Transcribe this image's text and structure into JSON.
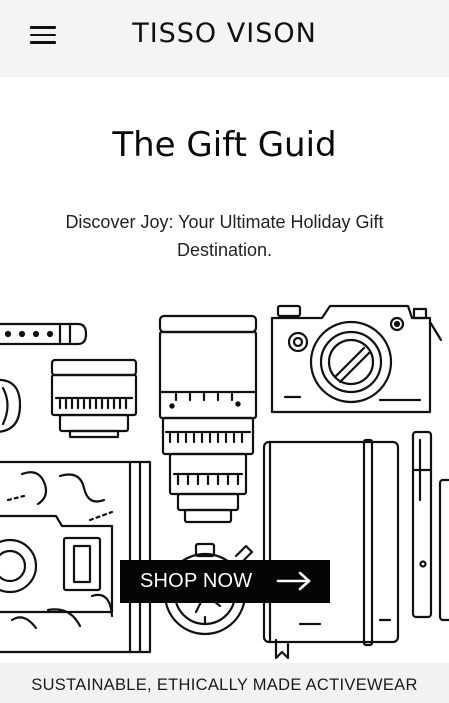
{
  "header": {
    "brand": "TISSO VISON",
    "menu_icon": "hamburger-menu-icon"
  },
  "hero": {
    "title": "The Gift Guid",
    "subtitle": "Discover Joy: Your Ultimate Holiday Gift Destination.",
    "cta_label": "SHOP NOW",
    "cta_icon": "arrow-right-icon"
  },
  "announcement": {
    "text": "SUSTAINABLE, ETHICALLY MADE ACTIVEWEAR"
  },
  "colors": {
    "header_bg": "#f4f4f4",
    "button_bg": "#050505",
    "button_text": "#ffffff",
    "announcement_bg": "#f2f2f2"
  }
}
